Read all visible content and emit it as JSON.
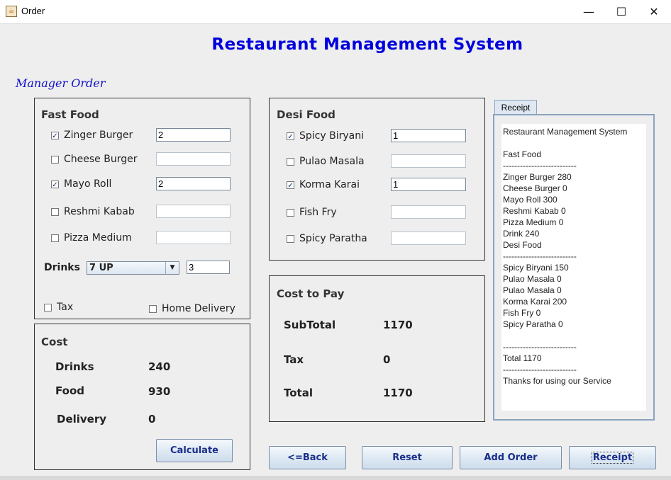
{
  "window": {
    "title": "Order",
    "minimize": "—",
    "maximize": "☐",
    "close": "✕",
    "icon": "java-cup-icon"
  },
  "heading": "Restaurant Management System",
  "section_label": "Manager Order",
  "fast_food": {
    "title": "Fast Food",
    "items": [
      {
        "label": "Zinger Burger",
        "checked": true,
        "qty": "2"
      },
      {
        "label": "Cheese Burger",
        "checked": false,
        "qty": ""
      },
      {
        "label": "Mayo Roll",
        "checked": true,
        "qty": "2"
      },
      {
        "label": "Reshmi Kabab",
        "checked": false,
        "qty": ""
      },
      {
        "label": "Pizza Medium",
        "checked": false,
        "qty": ""
      }
    ],
    "drinks_label": "Drinks",
    "drinks_selected": "7 UP",
    "drinks_qty": "3",
    "tax_label": "Tax",
    "tax_checked": false,
    "home_delivery_label": "Home Delivery",
    "home_delivery_checked": false
  },
  "desi_food": {
    "title": "Desi Food",
    "items": [
      {
        "label": "Spicy Biryani",
        "checked": true,
        "qty": "1"
      },
      {
        "label": "Pulao Masala",
        "checked": false,
        "qty": ""
      },
      {
        "label": "Korma Karai",
        "checked": true,
        "qty": "1"
      },
      {
        "label": "Fish Fry",
        "checked": false,
        "qty": ""
      },
      {
        "label": "Spicy Paratha",
        "checked": false,
        "qty": ""
      }
    ]
  },
  "cost": {
    "title": "Cost",
    "drinks_label": "Drinks",
    "drinks_value": "240",
    "food_label": "Food",
    "food_value": "930",
    "delivery_label": "Delivery",
    "delivery_value": "0",
    "calculate_label": "Calculate"
  },
  "cost_to_pay": {
    "title": "Cost to Pay",
    "subtotal_label": "SubTotal",
    "subtotal_value": "1170",
    "tax_label": "Tax",
    "tax_value": "0",
    "total_label": "Total",
    "total_value": "1170"
  },
  "receipt": {
    "tab_label": "Receipt",
    "lines": [
      "Restaurant Management System",
      "",
      "Fast Food",
      "--------------------------",
      "Zinger Burger 280",
      "Cheese Burger 0",
      "Mayo Roll 300",
      "Reshmi Kabab 0",
      "Pizza Medium 0",
      "Drink 240",
      "Desi Food",
      "--------------------------",
      "Spicy Biryani 150",
      "Pulao Masala 0",
      "Pulao Masala 0",
      "Korma Karai 200",
      "Fish Fry 0",
      "Spicy Paratha 0",
      "",
      "--------------------------",
      "Total 1170",
      "--------------------------",
      "Thanks for using our Service"
    ]
  },
  "buttons": {
    "back": "<=Back",
    "reset": "Reset",
    "add_order": "Add Order",
    "receipt": "Receipt"
  },
  "colors": {
    "heading": "#0000dd",
    "section_label": "#1010cc",
    "button_text": "#1a2e8a",
    "background": "#eeeeee"
  }
}
